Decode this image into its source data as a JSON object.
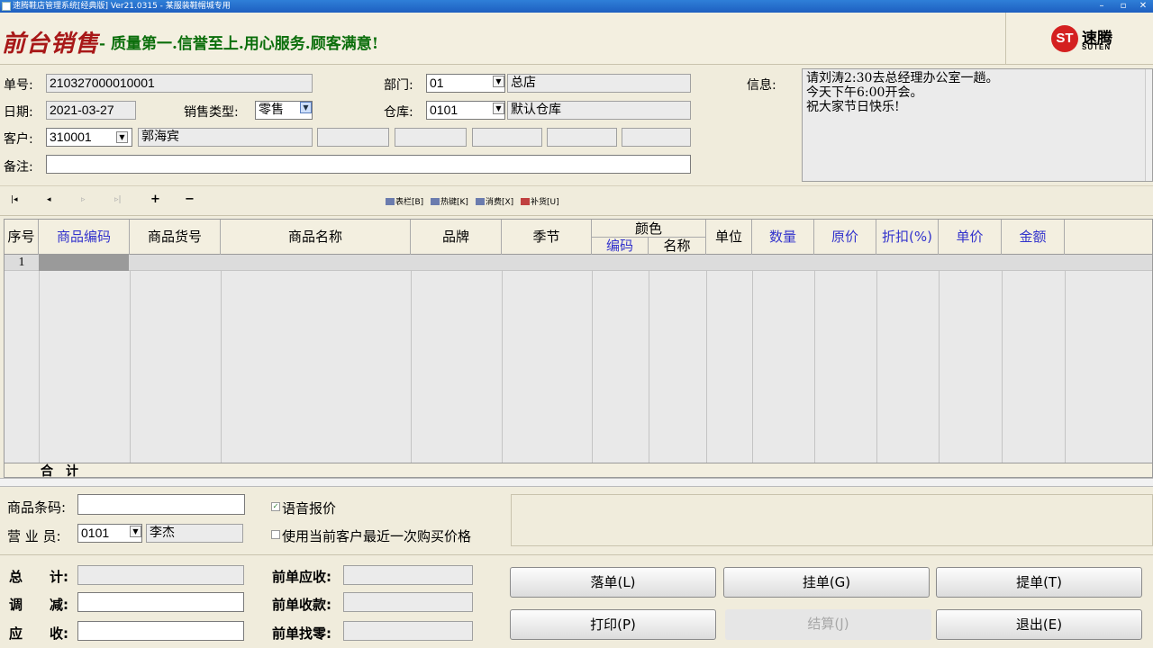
{
  "window": {
    "title": "速腾鞋店管理系统[经典版] Ver21.0315  -  某服装鞋帽城专用",
    "min_glyph": "–",
    "max_glyph": "▫",
    "close_glyph": "✕"
  },
  "banner": {
    "brand": "前台销售",
    "slogan": "- 质量第一.信誉至上.用心服务.顾客满意!",
    "logo_mark": "ST",
    "logo_cn": "速腾",
    "logo_en": "SUTEN"
  },
  "form": {
    "order_no_label": "单号:",
    "order_no": "210327000010001",
    "date_label": "日期:",
    "date": "2021-03-27",
    "sale_type_label": "销售类型:",
    "sale_type": "零售",
    "customer_label": "客户:",
    "customer_code": "310001",
    "customer_name": "郭海宾",
    "remark_label": "备注:",
    "remark": "",
    "dept_label": "部门:",
    "dept_code": "01",
    "dept_name": "总店",
    "warehouse_label": "仓库:",
    "warehouse_code": "0101",
    "warehouse_name": "默认仓库",
    "info_label": "信息:",
    "info_lines": [
      "请刘涛2:30去总经理办公室一趟。",
      "今天下午6:00开会。",
      "祝大家节日快乐!"
    ]
  },
  "nav": {
    "first": "|◂",
    "prev": "◂",
    "next": "▹",
    "last": "▹|",
    "add": "+",
    "remove": "−",
    "tools": [
      "表栏[B]",
      "热键[K]",
      "消费[X]",
      "补货[U]"
    ]
  },
  "grid": {
    "columns": [
      "序号",
      "商品编码",
      "商品货号",
      "商品名称",
      "品牌",
      "季节",
      "颜色",
      "单位",
      "数量",
      "原价",
      "折扣(%)",
      "单价",
      "金额"
    ],
    "color_sub": [
      "编码",
      "名称"
    ],
    "rows": [
      {
        "no": "1"
      }
    ],
    "total_label": "合　计"
  },
  "bottom": {
    "barcode_label": "商品条码:",
    "barcode": "",
    "salesman_label": "营 业 员:",
    "salesman_code": "0101",
    "salesman_name": "李杰",
    "voice_price_label": "语音报价",
    "voice_price_checked": true,
    "last_price_label": "使用当前客户最近一次购买价格",
    "last_price_checked": false,
    "total_label": "总　　计:",
    "adjust_label": "调　　减:",
    "receivable_label": "应　　收:",
    "prev_receivable_label": "前单应收:",
    "prev_received_label": "前单收款:",
    "prev_change_label": "前单找零:",
    "buttons": {
      "hold": "落单(L)",
      "suspend": "挂单(G)",
      "retrieve": "提单(T)",
      "print": "打印(P)",
      "settle": "结算(J)",
      "exit": "退出(E)"
    }
  }
}
